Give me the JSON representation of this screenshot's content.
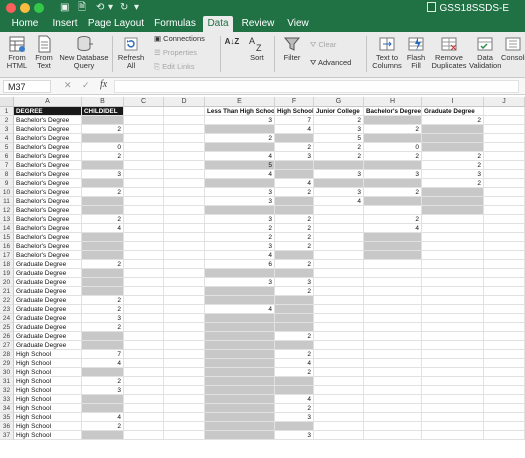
{
  "window": {
    "title": "GSS18SSDS-E",
    "quick_access": [
      "▣",
      "🗎",
      "⟲",
      "▾",
      "↻",
      "▾"
    ]
  },
  "tabs": [
    "Home",
    "Insert",
    "Page Layout",
    "Formulas",
    "Data",
    "Review",
    "View"
  ],
  "active_tab": "Data",
  "ribbon": {
    "from_html": [
      "From",
      "HTML"
    ],
    "from_text": [
      "From",
      "Text"
    ],
    "new_db_query": [
      "New Database",
      "Query"
    ],
    "refresh_all": [
      "Refresh",
      "All"
    ],
    "connections": "Connections",
    "properties": "Properties",
    "edit_links": "Edit Links",
    "sort_az": "A↓Z",
    "sort": "Sort",
    "filter": "Filter",
    "clear": "Clear",
    "advanced": "Advanced",
    "text_to_columns": [
      "Text to",
      "Columns"
    ],
    "flash_fill": [
      "Flash",
      "Fill"
    ],
    "remove_duplicates": [
      "Remove",
      "Duplicates"
    ],
    "data_validation": [
      "Data",
      "Validation"
    ],
    "consolidate": "Consolid"
  },
  "formula_bar": {
    "name_box": "M37",
    "cancel": "✕",
    "accept": "✓",
    "fx": "fx",
    "value": ""
  },
  "columns": [
    "A",
    "B",
    "C",
    "D",
    "E",
    "F",
    "G",
    "H",
    "I",
    "J"
  ],
  "rows": [
    {
      "n": "1",
      "A": "DEGREE",
      "B": "CHILDIDEL",
      "C": "",
      "D": "",
      "E": "Less Than High School",
      "F": "High School",
      "G": "Junior College",
      "H": "Bachelor's Degree",
      "I": "Graduate Degree"
    },
    {
      "n": "2",
      "A": "Bachelor's Degree",
      "B": "",
      "E": "3",
      "F": "7",
      "G": "2",
      "H": "",
      "I": "2"
    },
    {
      "n": "3",
      "A": "Bachelor's Degree",
      "B": "2",
      "E": "",
      "F": "4",
      "G": "3",
      "H": "2",
      "I": ""
    },
    {
      "n": "4",
      "A": "Bachelor's Degree",
      "B": "",
      "E": "2",
      "F": "",
      "G": "5",
      "H": "",
      "I": ""
    },
    {
      "n": "5",
      "A": "Bachelor's Degree",
      "B": "0",
      "E": "",
      "F": "2",
      "G": "2",
      "H": "0",
      "I": ""
    },
    {
      "n": "6",
      "A": "Bachelor's Degree",
      "B": "2",
      "E": "4",
      "F": "3",
      "G": "2",
      "H": "2",
      "I": "2"
    },
    {
      "n": "7",
      "A": "Bachelor's Degree",
      "B": "",
      "E": "5",
      "F": "",
      "G": "",
      "H": "",
      "I": "2"
    },
    {
      "n": "8",
      "A": "Bachelor's Degree",
      "B": "3",
      "E": "4",
      "F": "",
      "G": "3",
      "H": "3",
      "I": "3"
    },
    {
      "n": "9",
      "A": "Bachelor's Degree",
      "B": "",
      "E": "",
      "F": "4",
      "G": "",
      "H": "",
      "I": "2"
    },
    {
      "n": "10",
      "A": "Bachelor's Degree",
      "B": "2",
      "E": "3",
      "F": "2",
      "G": "3",
      "H": "2",
      "I": ""
    },
    {
      "n": "11",
      "A": "Bachelor's Degree",
      "B": "",
      "E": "3",
      "F": "",
      "G": "4",
      "H": "",
      "I": ""
    },
    {
      "n": "12",
      "A": "Bachelor's Degree",
      "B": "",
      "E": "",
      "F": "",
      "G": "",
      "H": "",
      "I": ""
    },
    {
      "n": "13",
      "A": "Bachelor's Degree",
      "B": "2",
      "E": "3",
      "F": "2",
      "G": "",
      "H": "2",
      "I": ""
    },
    {
      "n": "14",
      "A": "Bachelor's Degree",
      "B": "4",
      "E": "2",
      "F": "2",
      "G": "",
      "H": "4",
      "I": ""
    },
    {
      "n": "15",
      "A": "Bachelor's Degree",
      "B": "",
      "E": "2",
      "F": "2",
      "G": "",
      "H": "",
      "I": ""
    },
    {
      "n": "16",
      "A": "Bachelor's Degree",
      "B": "",
      "E": "3",
      "F": "2",
      "G": "",
      "H": "",
      "I": ""
    },
    {
      "n": "17",
      "A": "Bachelor's Degree",
      "B": "",
      "E": "4",
      "F": "",
      "G": "",
      "H": "",
      "I": ""
    },
    {
      "n": "18",
      "A": "Graduate Degree",
      "B": "2",
      "E": "6",
      "F": "2",
      "G": "",
      "H": "",
      "I": ""
    },
    {
      "n": "19",
      "A": "Graduate Degree",
      "B": "",
      "E": "",
      "F": "",
      "G": "",
      "H": "",
      "I": ""
    },
    {
      "n": "20",
      "A": "Graduate Degree",
      "B": "",
      "E": "3",
      "F": "3",
      "G": "",
      "H": "",
      "I": ""
    },
    {
      "n": "21",
      "A": "Graduate Degree",
      "B": "",
      "E": "",
      "F": "2",
      "G": "",
      "H": "",
      "I": ""
    },
    {
      "n": "22",
      "A": "Graduate Degree",
      "B": "2",
      "E": "",
      "F": "",
      "G": "",
      "H": "",
      "I": ""
    },
    {
      "n": "23",
      "A": "Graduate Degree",
      "B": "2",
      "E": "4",
      "F": "",
      "G": "",
      "H": "",
      "I": ""
    },
    {
      "n": "24",
      "A": "Graduate Degree",
      "B": "3",
      "E": "",
      "F": "",
      "G": "",
      "H": "",
      "I": ""
    },
    {
      "n": "25",
      "A": "Graduate Degree",
      "B": "2",
      "E": "",
      "F": "",
      "G": "",
      "H": "",
      "I": ""
    },
    {
      "n": "26",
      "A": "Graduate Degree",
      "B": "",
      "E": "",
      "F": "2",
      "G": "",
      "H": "",
      "I": ""
    },
    {
      "n": "27",
      "A": "Graduate Degree",
      "B": "",
      "E": "",
      "F": "",
      "G": "",
      "H": "",
      "I": ""
    },
    {
      "n": "28",
      "A": "High School",
      "B": "7",
      "E": "",
      "F": "2",
      "G": "",
      "H": "",
      "I": ""
    },
    {
      "n": "29",
      "A": "High School",
      "B": "4",
      "E": "",
      "F": "4",
      "G": "",
      "H": "",
      "I": ""
    },
    {
      "n": "30",
      "A": "High School",
      "B": "",
      "E": "",
      "F": "2",
      "G": "",
      "H": "",
      "I": ""
    },
    {
      "n": "31",
      "A": "High School",
      "B": "2",
      "E": "",
      "F": "",
      "G": "",
      "H": "",
      "I": ""
    },
    {
      "n": "32",
      "A": "High School",
      "B": "3",
      "E": "",
      "F": "",
      "G": "",
      "H": "",
      "I": ""
    },
    {
      "n": "33",
      "A": "High School",
      "B": "",
      "E": "",
      "F": "4",
      "G": "",
      "H": "",
      "I": ""
    },
    {
      "n": "34",
      "A": "High School",
      "B": "",
      "E": "",
      "F": "2",
      "G": "",
      "H": "",
      "I": ""
    },
    {
      "n": "35",
      "A": "High School",
      "B": "4",
      "E": "",
      "F": "3",
      "G": "",
      "H": "",
      "I": ""
    },
    {
      "n": "36",
      "A": "High School",
      "B": "2",
      "E": "",
      "F": "",
      "G": "",
      "H": "",
      "I": ""
    },
    {
      "n": "37",
      "A": "High School",
      "B": "",
      "E": "",
      "F": "3",
      "G": "",
      "H": "",
      "I": ""
    }
  ],
  "gray_cells": {
    "B": [
      "2",
      "4",
      "7",
      "9",
      "11",
      "12",
      "15",
      "16",
      "17",
      "19",
      "20",
      "21",
      "26",
      "27",
      "30",
      "33",
      "34",
      "37"
    ],
    "E": [
      "3",
      "5",
      "7",
      "9",
      "12",
      "19",
      "21",
      "22",
      "24",
      "25",
      "26",
      "27",
      "28",
      "29",
      "30",
      "31",
      "32",
      "33",
      "34",
      "35",
      "36",
      "37"
    ],
    "F": [
      "4",
      "7",
      "8",
      "11",
      "12",
      "17",
      "19",
      "22",
      "23",
      "24",
      "25",
      "27",
      "31",
      "32",
      "36"
    ],
    "G": [
      "7",
      "9"
    ],
    "H": [
      "2",
      "4",
      "7",
      "9",
      "11",
      "15",
      "16",
      "17"
    ],
    "I": [
      "3",
      "4",
      "5",
      "10",
      "11",
      "12"
    ]
  },
  "colors": {
    "excel_green": "#207245",
    "header_black": "#1a1a1a",
    "empty_gray": "#c8c8c8"
  }
}
